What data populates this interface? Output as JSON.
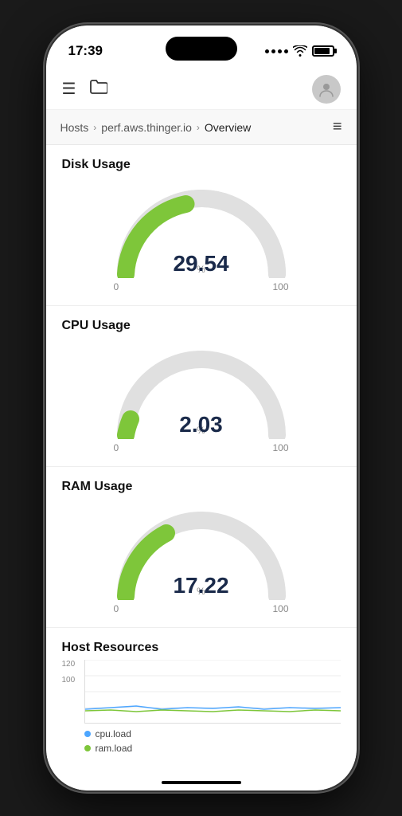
{
  "status_bar": {
    "time": "17:39"
  },
  "nav": {
    "hamburger_label": "☰",
    "folder_label": "☐"
  },
  "breadcrumb": {
    "hosts": "Hosts",
    "host": "perf.aws.thinger.io",
    "page": "Overview"
  },
  "disk_usage": {
    "title": "Disk Usage",
    "value": "29.54",
    "unit": "%",
    "min": "0",
    "max": "100",
    "percent": 29.54,
    "color": "#7ec63a"
  },
  "cpu_usage": {
    "title": "CPU Usage",
    "value": "2.03",
    "unit": "%",
    "min": "0",
    "max": "100",
    "percent": 2.03,
    "color": "#7ec63a"
  },
  "ram_usage": {
    "title": "RAM Usage",
    "value": "17.22",
    "unit": "%",
    "min": "0",
    "max": "100",
    "percent": 17.22,
    "color": "#7ec63a"
  },
  "host_resources": {
    "title": "Host Resources",
    "y_max": "120",
    "y_100": "100",
    "legend": [
      {
        "label": "cpu.load",
        "color": "#4da6ff"
      },
      {
        "label": "ram.load",
        "color": "#7ec63a"
      }
    ]
  }
}
